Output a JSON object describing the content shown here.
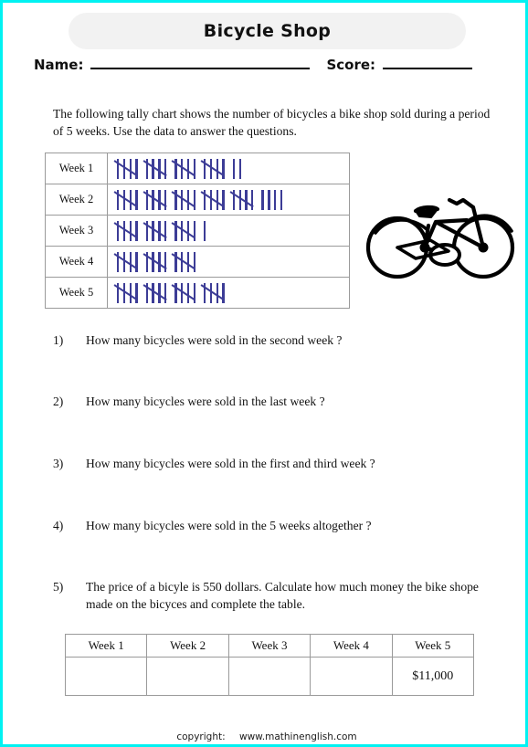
{
  "page": {
    "border_color": "#00f2f2",
    "background": "#ffffff"
  },
  "header": {
    "title": "Bicycle Shop",
    "title_bg": "#f2f2f2",
    "name_label": "Name:",
    "score_label": "Score:"
  },
  "intro": {
    "text": "The following tally chart shows the number of bicycles a bike shop sold during a period of 5 weeks. Use the data to answer the questions."
  },
  "tally_chart": {
    "mark_color": "#3c3c96",
    "rows": [
      {
        "label": "Week 1",
        "groups_of_five": 4,
        "singles": 2,
        "total": 22
      },
      {
        "label": "Week 2",
        "groups_of_five": 5,
        "singles": 4,
        "total": 29
      },
      {
        "label": "Week 3",
        "groups_of_five": 3,
        "singles": 1,
        "total": 16
      },
      {
        "label": "Week 4",
        "groups_of_five": 3,
        "singles": 0,
        "total": 15
      },
      {
        "label": "Week 5",
        "groups_of_five": 4,
        "singles": 0,
        "total": 20
      }
    ]
  },
  "illustration": {
    "name": "bicycle-icon",
    "color": "#000000"
  },
  "questions": [
    {
      "number": "1)",
      "text": "How many bicycles were sold in the second week ?"
    },
    {
      "number": "2)",
      "text": "How many bicycles were sold in the last week ?"
    },
    {
      "number": "3)",
      "text": "How many bicycles were sold in the first and third week ?"
    },
    {
      "number": "4)",
      "text": "How many bicycles were sold in the 5 weeks altogether ?"
    },
    {
      "number": "5)",
      "text": "The price of a bicyle is 550 dollars. Calculate how much money the bike shope made on the bicyces and complete the table."
    }
  ],
  "money_table": {
    "headers": [
      "Week 1",
      "Week 2",
      "Week 3",
      "Week 4",
      "Week 5"
    ],
    "values": [
      "",
      "",
      "",
      "",
      "$11,000"
    ]
  },
  "footer": {
    "copyright_label": "copyright:",
    "url": "www.mathinenglish.com"
  },
  "chart_data": {
    "type": "table",
    "title": "Bicycle Shop tally chart",
    "categories": [
      "Week 1",
      "Week 2",
      "Week 3",
      "Week 4",
      "Week 5"
    ],
    "values": [
      22,
      29,
      16,
      15,
      20
    ],
    "xlabel": "Week",
    "ylabel": "Bicycles sold",
    "notes": "Tally marks: groups of five (four sticks with diagonal strike) plus singles",
    "unit_price_dollars": 550,
    "revenue_values": [
      "",
      "",
      "",
      "",
      "$11,000"
    ]
  }
}
